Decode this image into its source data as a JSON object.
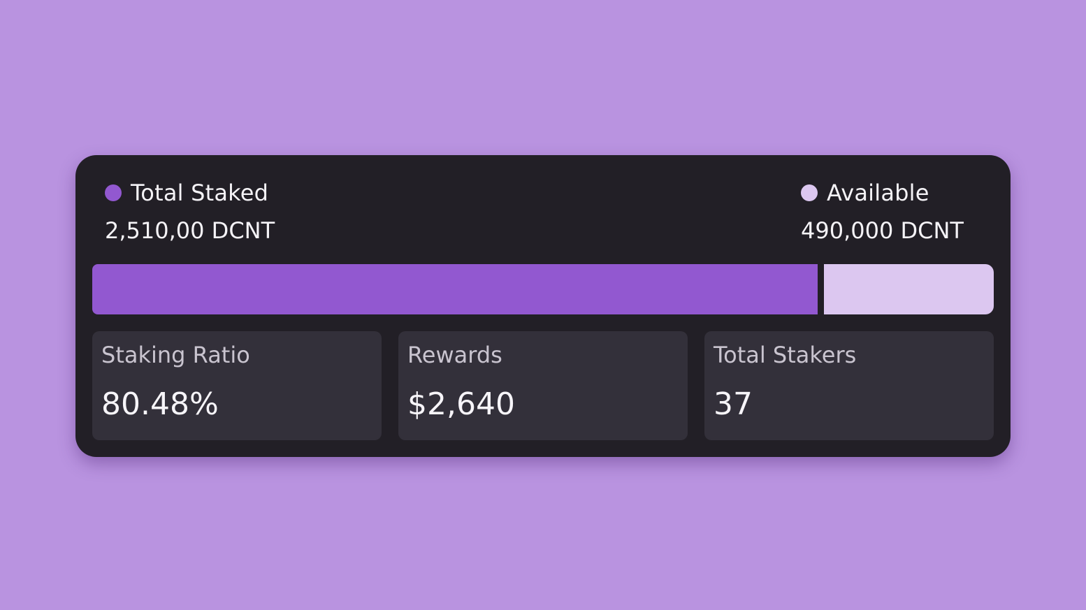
{
  "legend": {
    "staked": {
      "label": "Total Staked",
      "value": "2,510,00 DCNT",
      "color": "#9258d0"
    },
    "available": {
      "label": "Available",
      "value": "490,000 DCNT",
      "color": "#dcc7f0"
    }
  },
  "progress": {
    "staked_fraction": 0.8048
  },
  "stats": [
    {
      "label": "Staking Ratio",
      "value": "80.48%"
    },
    {
      "label": "Rewards",
      "value": "$2,640"
    },
    {
      "label": "Total Stakers",
      "value": "37"
    }
  ],
  "colors": {
    "background": "#b993e0",
    "card": "#221f26",
    "stat_card": "#33303a"
  }
}
